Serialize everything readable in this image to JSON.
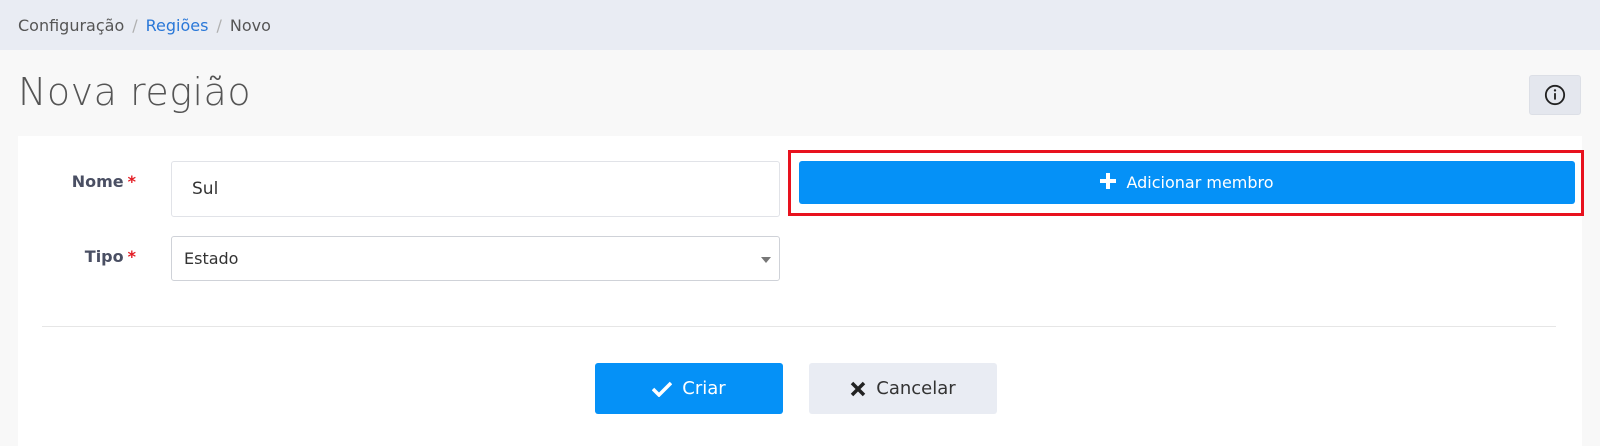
{
  "breadcrumb": {
    "items": [
      "Configuração",
      "Regiões",
      "Novo"
    ],
    "separator": "/"
  },
  "page": {
    "title": "Nova região"
  },
  "info_button": {
    "icon": "info-circle-icon"
  },
  "form": {
    "name": {
      "label": "Nome",
      "required_mark": "*",
      "value": "Sul"
    },
    "type": {
      "label": "Tipo",
      "required_mark": "*",
      "selected": "Estado"
    }
  },
  "add_member": {
    "label": "Adicionar membro",
    "icon": "plus-icon"
  },
  "actions": {
    "create": {
      "label": "Criar",
      "icon": "check-icon"
    },
    "cancel": {
      "label": "Cancelar",
      "icon": "close-icon"
    }
  },
  "colors": {
    "primary": "#0591f7",
    "highlight": "#e8121e",
    "required": "#e31b23",
    "link": "#2a78d8"
  }
}
